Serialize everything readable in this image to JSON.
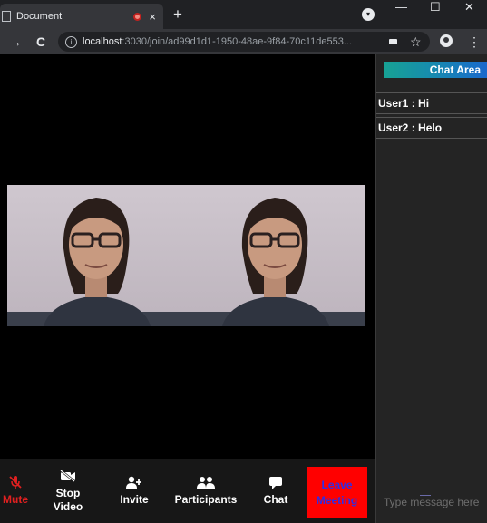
{
  "browser": {
    "tab_title": "Document",
    "new_tab": "+",
    "close_tab": "×",
    "minimize": "—",
    "maximize": "☐",
    "close_window": "✕",
    "back": "→",
    "reload": "C",
    "url_host": "localhost",
    "url_path": ":3030/join/ad99d1d1-1950-48ae-9f84-70c11de553...",
    "menu": "⋮",
    "star": "☆"
  },
  "colors": {
    "leave_bg": "#ff0000",
    "leave_text": "#2e2ee6",
    "mute": "#e02020",
    "chat_header_start": "#17a294",
    "chat_header_end": "#1a68cc"
  },
  "controls": {
    "mute": "Mute",
    "stop_video_1": "Stop",
    "stop_video_2": "Video",
    "invite": "Invite",
    "participants": "Participants",
    "chat": "Chat",
    "leave_1": "Leave",
    "leave_2": "Meeting"
  },
  "icons": {
    "mute": "microphone-slash-icon",
    "stop_video": "video-slash-icon",
    "invite": "user-plus-icon",
    "participants": "users-icon",
    "chat": "comment-icon"
  },
  "chat": {
    "header": "Chat Area",
    "messages": [
      {
        "text": "User1 : Hi"
      },
      {
        "text": "User2 : Helo"
      }
    ],
    "input_placeholder": "Type message here"
  }
}
